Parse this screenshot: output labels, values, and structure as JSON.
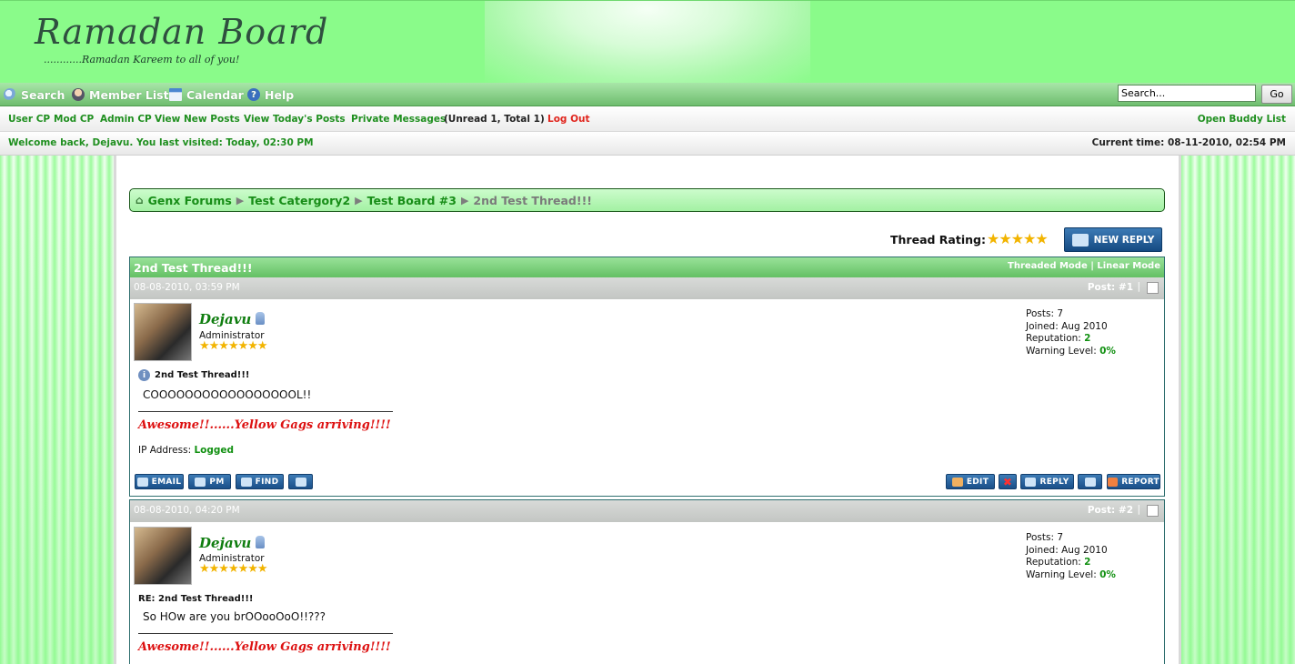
{
  "header": {
    "logo": "Ramadan Board",
    "tagline": "............Ramadan Kareem to all of you!"
  },
  "menu": {
    "items": [
      "Search",
      "Member List",
      "Calendar",
      "Help"
    ],
    "search_value": "Search...",
    "go_label": "Go"
  },
  "links": {
    "items": [
      "User CP",
      "Mod CP",
      "Admin CP",
      "View New Posts",
      "View Today's Posts",
      "Private Messages"
    ],
    "pm_counts": "(Unread 1, Total 1)",
    "logout": "Log Out",
    "buddy": "Open Buddy List"
  },
  "welcome": {
    "text": "Welcome back, Dejavu. You last visited: Today, 02:30 PM",
    "time": "Current time: 08-11-2010, 02:54 PM"
  },
  "breadcrumb": [
    "Genx Forums",
    "Test Catergory2",
    "Test Board #3",
    "2nd Test Thread!!!"
  ],
  "thread": {
    "rating_label": "Thread Rating:",
    "rating_stars": "★★★★★",
    "new_reply": "NEW REPLY",
    "title": "2nd Test Thread!!!",
    "threaded": "Threaded Mode",
    "divider": "|",
    "linear": "Linear Mode"
  },
  "posts": [
    {
      "date": "08-08-2010, 03:59 PM",
      "number": "Post: #1",
      "username": "Dejavu",
      "usertitle": "Administrator",
      "stars": "★★★★★★★",
      "posts_label": "Posts:",
      "posts": "7",
      "joined_label": "Joined:",
      "joined": "Aug 2010",
      "rep_label": "Reputation:",
      "rep": "2",
      "warn_label": "Warning Level:",
      "warn": "0%",
      "title": "2nd Test Thread!!!",
      "body": "COOOOOOOOOOOOOOOOOL!!",
      "signature": "Awesome!!......Yellow Gags arriving!!!!",
      "ip_label": "IP Address:",
      "ip_value": "Logged",
      "buttons_left": [
        "EMAIL",
        "PM",
        "FIND"
      ],
      "buttons_right": [
        "EDIT",
        "REPLY",
        "REPORT"
      ]
    },
    {
      "date": "08-08-2010, 04:20 PM",
      "number": "Post: #2",
      "username": "Dejavu",
      "usertitle": "Administrator",
      "stars": "★★★★★★★",
      "posts_label": "Posts:",
      "posts": "7",
      "joined_label": "Joined:",
      "joined": "Aug 2010",
      "rep_label": "Reputation:",
      "rep": "2",
      "warn_label": "Warning Level:",
      "warn": "0%",
      "title": "RE: 2nd Test Thread!!!",
      "body": "So HOw are you brOOooOoO!!???",
      "signature": "Awesome!!......Yellow Gags arriving!!!!"
    }
  ],
  "colors": {
    "page_green": "#86f986",
    "link_green": "#1f8f1f",
    "logout_red": "#e0241c",
    "button_blue": "#1a4f88"
  }
}
